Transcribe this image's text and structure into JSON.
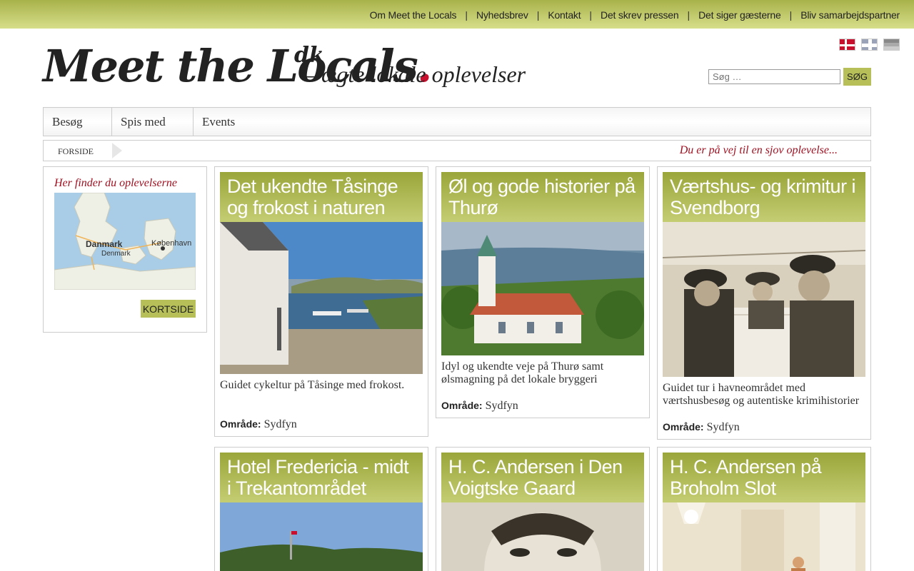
{
  "topnav": {
    "items": [
      "Om Meet the Locals",
      "Nyhedsbrev",
      "Kontakt",
      "Det skrev pressen",
      "Det siger gæsterne",
      "Bliv samarbejdspartner"
    ]
  },
  "logo": {
    "brand": "Meet the Locals",
    "dot": ".",
    "tld": "dk",
    "tagline": "– ægte lokale oplevelser"
  },
  "languages": [
    "flag-denmark-icon",
    "flag-uk-icon",
    "flag-germany-icon"
  ],
  "search": {
    "placeholder": "Søg …",
    "button": "SØG"
  },
  "mainnav": [
    "Besøg",
    "Spis med",
    "Events"
  ],
  "breadcrumb": {
    "home": "FORSIDE",
    "slogan": "Du er på vej til en sjov oplevelse..."
  },
  "sidebar": {
    "title": "Her finder du oplevelserne",
    "map_labels": [
      "Danmark",
      "Denmark",
      "København"
    ],
    "button": "KORTSIDE"
  },
  "cards": [
    {
      "title": "Det ukendte Tåsinge og frokost i naturen",
      "description": "Guidet cykeltur på Tåsinge med frokost.",
      "area_label": "Område:",
      "area": "Sydfyn"
    },
    {
      "title": "Øl og gode historier på Thurø",
      "description": "Idyl og ukendte veje på Thurø samt ølsmagning på det lokale bryggeri",
      "area_label": "Område:",
      "area": "Sydfyn"
    },
    {
      "title": "Værtshus- og krimitur i Svendborg",
      "description": "Guidet tur i havneområdet med værtshusbesøg og autentiske krimihistorier",
      "area_label": "Område:",
      "area": "Sydfyn"
    },
    {
      "title": "Hotel Fredericia - midt i Trekantområdet"
    },
    {
      "title": "H. C. Andersen i Den Voigtske Gaard"
    },
    {
      "title": "H. C. Andersen på Broholm Slot"
    }
  ],
  "colors": {
    "accent": "#b6bf58",
    "slogan_red": "#a01020",
    "logo_dot": "#c8102e"
  }
}
